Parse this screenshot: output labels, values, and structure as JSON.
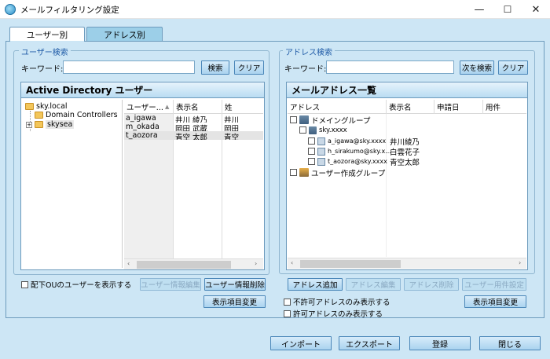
{
  "window": {
    "title": "メールフィルタリング設定",
    "min": "—",
    "max": "☐",
    "close": "✕"
  },
  "tabs": [
    {
      "label": "ユーザー別"
    },
    {
      "label": "アドレス別"
    }
  ],
  "user_search": {
    "legend": "ユーザー検索",
    "keyword_label": "キーワード:",
    "keyword_value": "",
    "search_btn": "検索",
    "clear_btn": "クリア"
  },
  "ad_panel": {
    "title": "Active Directory ユーザー",
    "tree": [
      {
        "label": "sky.local"
      },
      {
        "label": "Domain Controllers"
      },
      {
        "label": "skysea"
      }
    ],
    "columns": [
      "ユーザー...",
      "表示名",
      "姓"
    ],
    "rows": [
      [
        "a_igawa",
        "井川 綾乃",
        "井川"
      ],
      [
        "m_okada",
        "岡田 武蔵",
        "岡田"
      ],
      [
        "t_aozora",
        "青空 太郎",
        "青空"
      ]
    ]
  },
  "left_bottom": {
    "show_ou_label": "配下OUのユーザーを表示する",
    "edit_user_btn": "ユーザー情報編集",
    "delete_user_btn": "ユーザー情報削除",
    "change_cols_btn": "表示項目変更"
  },
  "addr_search": {
    "legend": "アドレス検索",
    "keyword_label": "キーワード:",
    "keyword_value": "",
    "next_btn": "次を検索",
    "clear_btn": "クリア"
  },
  "mail_panel": {
    "title": "メールアドレス一覧",
    "columns": [
      "アドレス",
      "表示名",
      "申請日",
      "用件"
    ],
    "tree": [
      {
        "label": "ドメイングループ",
        "name": ""
      },
      {
        "label": "sky.xxxx",
        "name": ""
      },
      {
        "label": "a_igawa@sky.xxxx",
        "name": "井川綾乃"
      },
      {
        "label": "h_sirakumo@sky.x...",
        "name": "白雲花子"
      },
      {
        "label": "t_aozora@sky.xxxx",
        "name": "青空太郎"
      },
      {
        "label": "ユーザー作成グループ",
        "name": ""
      }
    ]
  },
  "right_bottom": {
    "add_btn": "アドレス追加",
    "edit_btn": "アドレス編集",
    "delete_btn": "アドレス削除",
    "reqset_btn": "ユーザー用件設定",
    "deny_only_label": "不許可アドレスのみ表示する",
    "allow_only_label": "許可アドレスのみ表示する",
    "change_cols_btn": "表示項目変更"
  },
  "footer": {
    "import_btn": "インポート",
    "export_btn": "エクスポート",
    "register_btn": "登録",
    "close_btn": "閉じる"
  }
}
